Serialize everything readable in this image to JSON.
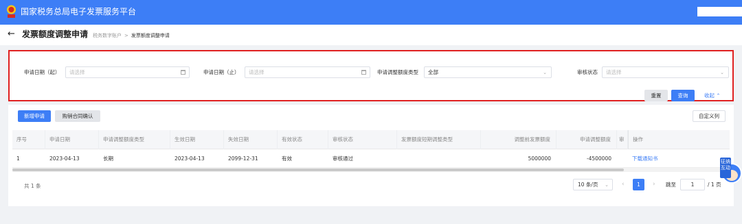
{
  "app": {
    "title": "国家税务总局电子发票服务平台",
    "brand_color": "#3d7ef6"
  },
  "page": {
    "title": "发票额度调整申请",
    "breadcrumbs": [
      "税务数字账户",
      "发票额度调整申请"
    ]
  },
  "filters": {
    "start_date": {
      "label": "申请日期（起）",
      "placeholder": "请选择"
    },
    "end_date": {
      "label": "申请日期（止）",
      "placeholder": "请选择"
    },
    "adjust_type": {
      "label": "申请调整额度类型",
      "value": "全部"
    },
    "review_status": {
      "label": "审核状态",
      "placeholder": "请选择"
    },
    "reset_label": "重置",
    "query_label": "查询",
    "collapse_label": "收起"
  },
  "toolbar": {
    "new_label": "新增申请",
    "confirm_label": "购销合同确认",
    "columns_label": "自定义列"
  },
  "table": {
    "headers": [
      "序号",
      "申请日期",
      "申请调整额度类型",
      "生效日期",
      "失效日期",
      "有效状态",
      "审核状态",
      "发票额度短期调整类型",
      "调整前发票额度",
      "申请调整额度",
      "审",
      "操作"
    ],
    "rows": [
      [
        "1",
        "2023-04-13",
        "长期",
        "2023-04-13",
        "2099-12-31",
        "有效",
        "审核通过",
        "",
        "5000000",
        "-4500000",
        "",
        "下载通知书"
      ]
    ]
  },
  "pagination": {
    "total": "共 1 条",
    "page_size": "10 条/页",
    "current_page": "1",
    "jump_label": "跳至",
    "jump_value": "1",
    "page_total": "/ 1 页"
  },
  "assistant": {
    "label": "征纳互动"
  }
}
